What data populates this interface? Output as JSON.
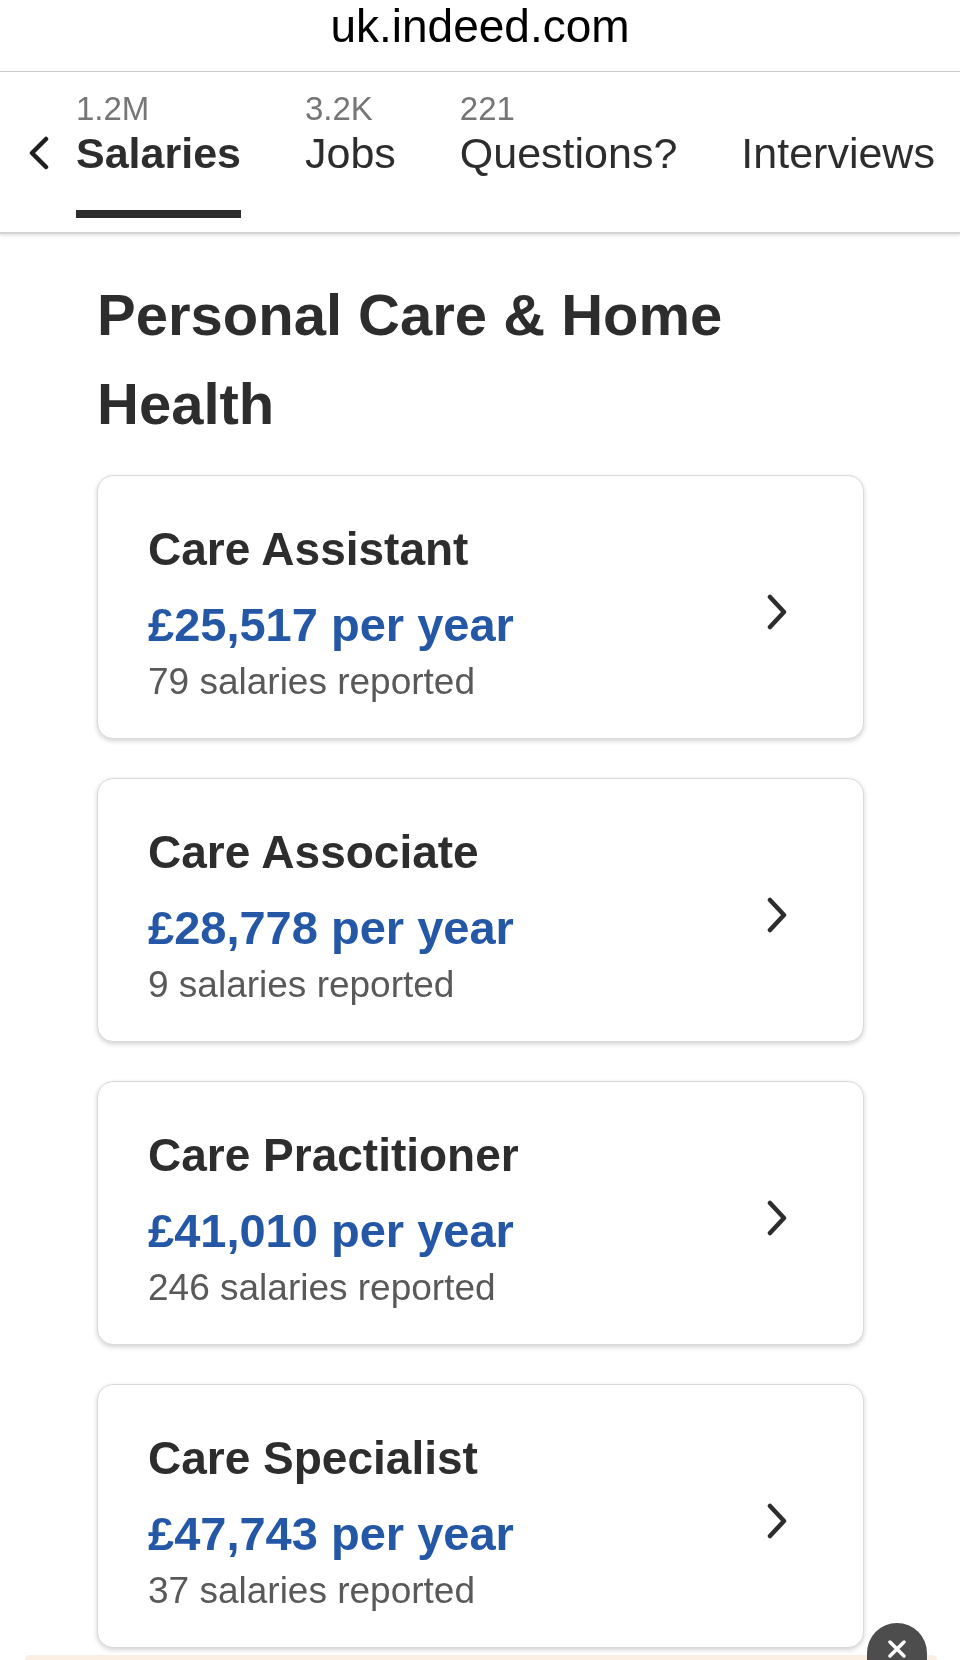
{
  "browser": {
    "url": "uk.indeed.com"
  },
  "tabs": [
    {
      "count": "1.2M",
      "label": "Salaries",
      "selected": true
    },
    {
      "count": "3.2K",
      "label": "Jobs",
      "selected": false
    },
    {
      "count": "221",
      "label": "Questions?",
      "selected": false
    },
    {
      "label": "Interviews",
      "selected": false
    }
  ],
  "heading": "Personal Care & Home Health",
  "cards": [
    {
      "title": "Care Assistant",
      "salary": "£25,517 per year",
      "reports": "79 salaries reported"
    },
    {
      "title": "Care Associate",
      "salary": "£28,778 per year",
      "reports": "9 salaries reported"
    },
    {
      "title": "Care Practitioner",
      "salary": "£41,010 per year",
      "reports": "246 salaries reported"
    },
    {
      "title": "Care Specialist",
      "salary": "£47,743 per year",
      "reports": "37 salaries reported"
    }
  ]
}
